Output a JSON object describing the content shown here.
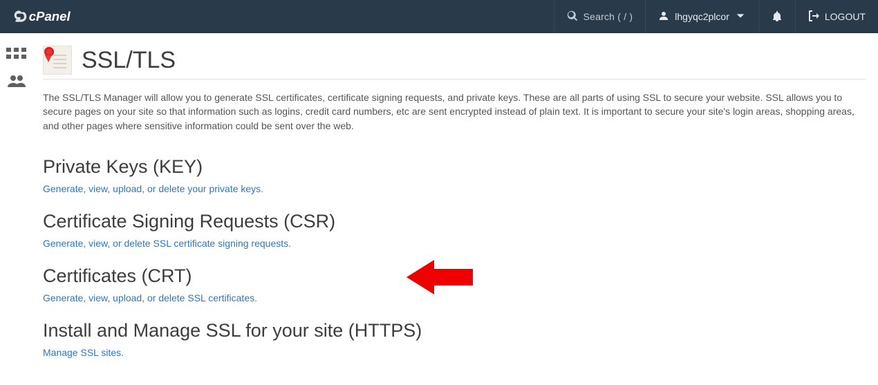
{
  "header": {
    "search_label": "Search ( / )",
    "username": "lhgyqc2plcor",
    "logout": "LOGOUT"
  },
  "page": {
    "title": "SSL/TLS",
    "description": "The SSL/TLS Manager will allow you to generate SSL certificates, certificate signing requests, and private keys. These are all parts of using SSL to secure your website. SSL allows you to secure pages on your site so that information such as logins, credit card numbers, etc are sent encrypted instead of plain text. It is important to secure your site's login areas, shopping areas, and other pages where sensitive information could be sent over the web."
  },
  "sections": {
    "private_keys": {
      "heading": "Private Keys (KEY)",
      "link": "Generate, view, upload, or delete your private keys."
    },
    "csr": {
      "heading": "Certificate Signing Requests (CSR)",
      "link": "Generate, view, or delete SSL certificate signing requests."
    },
    "crt": {
      "heading": "Certificates (CRT)",
      "link": "Generate, view, upload, or delete SSL certificates."
    },
    "install": {
      "heading": "Install and Manage SSL for your site (HTTPS)",
      "link": "Manage SSL sites."
    }
  }
}
